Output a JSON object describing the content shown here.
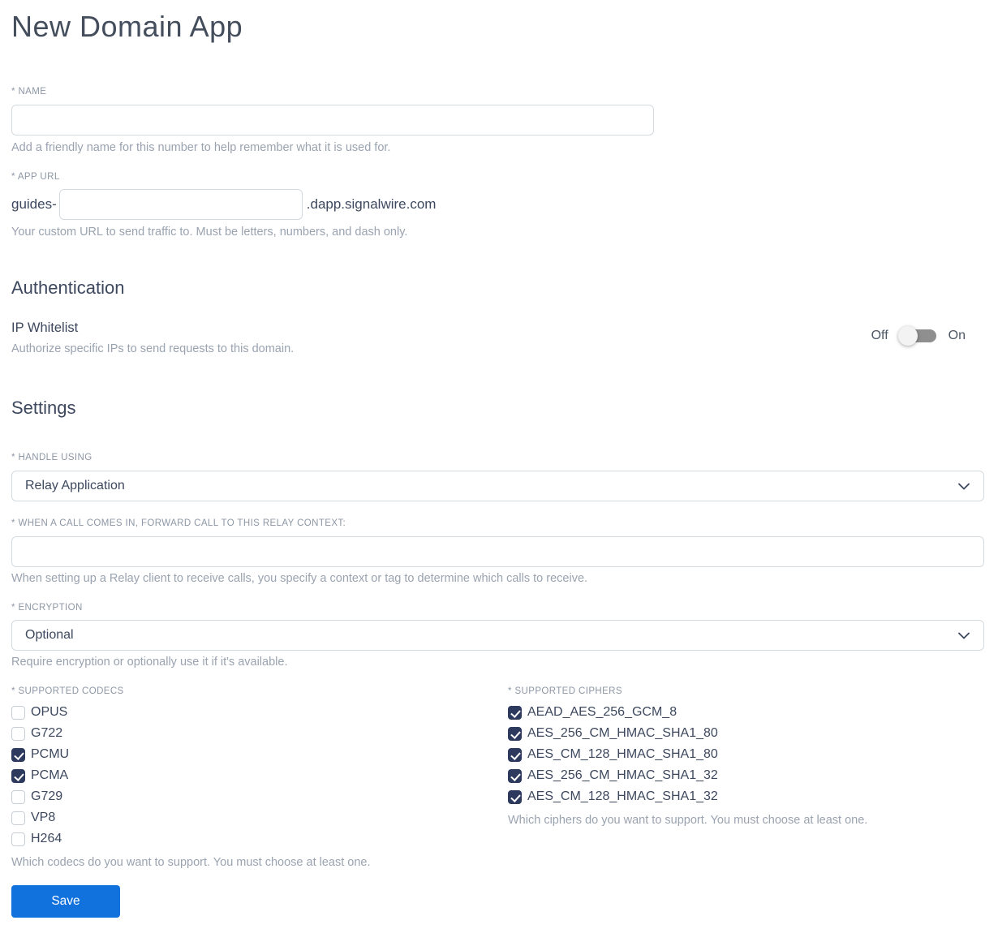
{
  "page": {
    "title": "New Domain App"
  },
  "name_field": {
    "label": "* NAME",
    "value": "",
    "helper": "Add a friendly name for this number to help remember what it is used for."
  },
  "app_url_field": {
    "label": "* APP URL",
    "prefix": "guides-",
    "value": "",
    "suffix": ".dapp.signalwire.com",
    "helper": "Your custom URL to send traffic to. Must be letters, numbers, and dash only."
  },
  "authentication": {
    "heading": "Authentication",
    "ip_whitelist": {
      "label": "IP Whitelist",
      "helper": "Authorize specific IPs to send requests to this domain.",
      "off_label": "Off",
      "on_label": "On",
      "state": "off"
    }
  },
  "settings": {
    "heading": "Settings",
    "handle_using": {
      "label": "* HANDLE USING",
      "selected": "Relay Application"
    },
    "relay_context": {
      "label": "* WHEN A CALL COMES IN, FORWARD CALL TO THIS RELAY CONTEXT:",
      "value": "",
      "helper": "When setting up a Relay client to receive calls, you specify a context or tag to determine which calls to receive."
    },
    "encryption": {
      "label": "* ENCRYPTION",
      "selected": "Optional",
      "helper": "Require encryption or optionally use it if it's available."
    },
    "codecs": {
      "label": "* SUPPORTED CODECS",
      "options": [
        {
          "label": "OPUS",
          "checked": false
        },
        {
          "label": "G722",
          "checked": false
        },
        {
          "label": "PCMU",
          "checked": true
        },
        {
          "label": "PCMA",
          "checked": true
        },
        {
          "label": "G729",
          "checked": false
        },
        {
          "label": "VP8",
          "checked": false
        },
        {
          "label": "H264",
          "checked": false
        }
      ],
      "helper": "Which codecs do you want to support. You must choose at least one."
    },
    "ciphers": {
      "label": "* SUPPORTED CIPHERS",
      "options": [
        {
          "label": "AEAD_AES_256_GCM_8",
          "checked": true
        },
        {
          "label": "AES_256_CM_HMAC_SHA1_80",
          "checked": true
        },
        {
          "label": "AES_CM_128_HMAC_SHA1_80",
          "checked": true
        },
        {
          "label": "AES_256_CM_HMAC_SHA1_32",
          "checked": true
        },
        {
          "label": "AES_CM_128_HMAC_SHA1_32",
          "checked": true
        }
      ],
      "helper": "Which ciphers do you want to support. You must choose at least one."
    }
  },
  "actions": {
    "save_label": "Save"
  },
  "colors": {
    "accent_blue": "#1171dd",
    "checkbox_navy": "#2d3a5e",
    "text_dark": "#3d485e",
    "text_gray": "#9aa3b0",
    "border_gray": "#d5dade",
    "toggle_track": "#8f8f8f"
  }
}
